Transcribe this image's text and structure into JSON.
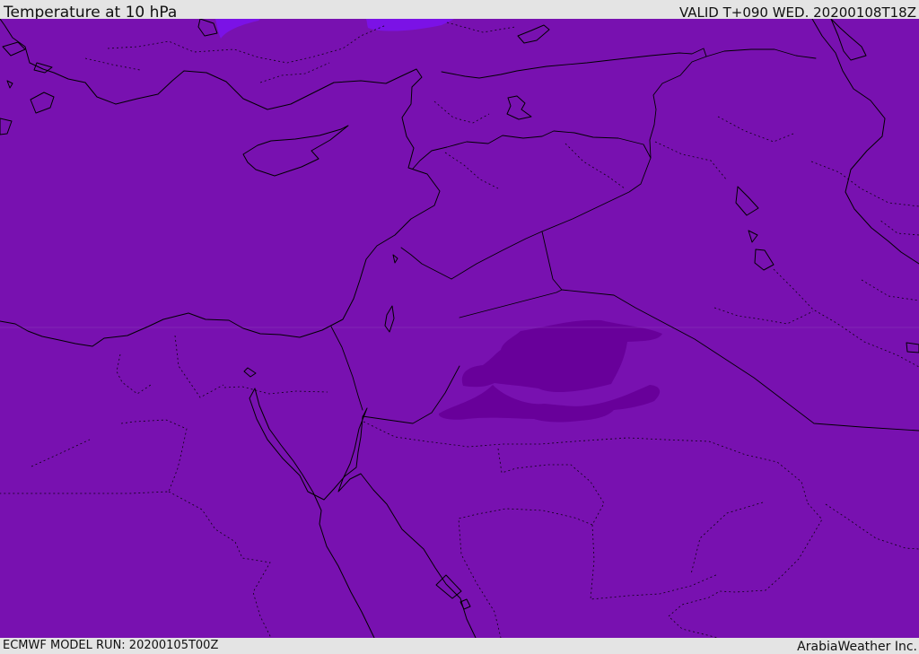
{
  "header": {
    "title": "Temperature at 10 hPa",
    "valid": "VALID T+090 WED. 20200108T18Z"
  },
  "footer": {
    "model_run": "ECMWF MODEL RUN: 20200105T00Z",
    "credit": "ArabiaWeather Inc."
  },
  "colors": {
    "frame": "#e4e4e4",
    "field_base": "#7811b0",
    "field_cold": "#68009a",
    "field_warm": "#7b12e6",
    "coastline": "#000000"
  },
  "map": {
    "region": "Eastern Mediterranean and Middle East"
  }
}
